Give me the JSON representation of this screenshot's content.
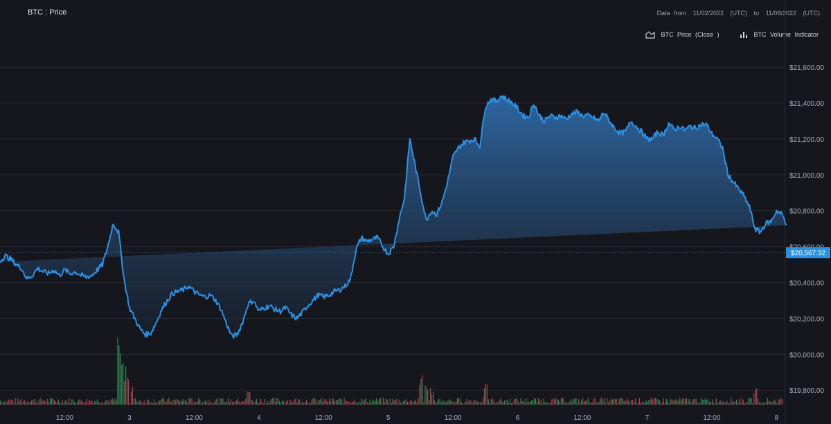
{
  "header": {
    "title": "BTC : Price",
    "range_prefix": "Data  from",
    "range_start": "11/02/2022",
    "range_start_tz": "(UTC)",
    "range_to": "to",
    "range_end": "11/08/2022",
    "range_end_tz": "(UTC)"
  },
  "legend": {
    "price_label": "BTC  Price  (Close  )",
    "volume_label": "BTC  Volume  Indicator",
    "price_icon": "area-chart-icon",
    "volume_icon": "bar-chart-icon"
  },
  "current_price_label": "$20,567.32",
  "colors": {
    "background": "#16171c",
    "line": "#2a92e6",
    "fill_top": "#2f6aa8",
    "price_tag": "#2a92e6",
    "volume_up": "#2f9a5a",
    "volume_down": "#c0465a"
  },
  "chart_data": {
    "type": "area",
    "title": "BTC : Price",
    "xlabel": "",
    "ylabel": "",
    "ylim": [
      19720,
      21720
    ],
    "y_ticks": [
      "$19,800.00",
      "$20,000.00",
      "$20,200.00",
      "$20,400.00",
      "$20,600.00",
      "$20,800.00",
      "$21,000.00",
      "$21,200.00",
      "$21,400.00",
      "$21,600.00"
    ],
    "y_tick_values": [
      19800,
      20000,
      20200,
      20400,
      20600,
      20800,
      21000,
      21200,
      21400,
      21600
    ],
    "x_ticks": [
      "12:00",
      "3",
      "12:00",
      "4",
      "12:00",
      "5",
      "12:00",
      "6",
      "12:00",
      "7",
      "12:00",
      "8"
    ],
    "x_tick_hours": [
      12,
      24,
      36,
      48,
      60,
      72,
      84,
      96,
      108,
      120,
      132,
      144
    ],
    "grid": true,
    "legend_position": "top-right",
    "series": [
      {
        "name": "BTC  Price  (Close  )",
        "x_hours": [
          0,
          1,
          2,
          3,
          4,
          5,
          6,
          7,
          8,
          9,
          10,
          11,
          12,
          13,
          14,
          15,
          16,
          17,
          18,
          19,
          20,
          21,
          22,
          23,
          24,
          25,
          26,
          27,
          28,
          29,
          30,
          31,
          32,
          33,
          34,
          35,
          36,
          37,
          38,
          39,
          40,
          41,
          42,
          43,
          44,
          45,
          46,
          47,
          48,
          49,
          50,
          51,
          52,
          53,
          54,
          55,
          56,
          57,
          58,
          59,
          60,
          61,
          62,
          63,
          64,
          65,
          66,
          67,
          68,
          69,
          70,
          71,
          72,
          73,
          74,
          75,
          76,
          77,
          78,
          79,
          80,
          81,
          82,
          83,
          84,
          85,
          86,
          87,
          88,
          89,
          90,
          91,
          92,
          93,
          94,
          95,
          96,
          97,
          98,
          99,
          100,
          101,
          102,
          103,
          104,
          105,
          106,
          107,
          108,
          109,
          110,
          111,
          112,
          113,
          114,
          115,
          116,
          117,
          118,
          119,
          120,
          121,
          122,
          123,
          124,
          125,
          126,
          127,
          128,
          129,
          130,
          131,
          132,
          133,
          134,
          135,
          136,
          137,
          138,
          139,
          140,
          141,
          142,
          143,
          144,
          145
        ],
        "values": [
          20520,
          20550,
          20530,
          20500,
          20480,
          20420,
          20440,
          20480,
          20460,
          20450,
          20470,
          20440,
          20470,
          20450,
          20460,
          20440,
          20430,
          20440,
          20470,
          20500,
          20600,
          20730,
          20680,
          20420,
          20260,
          20200,
          20140,
          20110,
          20120,
          20180,
          20250,
          20300,
          20340,
          20350,
          20360,
          20380,
          20350,
          20330,
          20320,
          20330,
          20300,
          20250,
          20170,
          20100,
          20110,
          20180,
          20280,
          20300,
          20240,
          20260,
          20270,
          20250,
          20240,
          20260,
          20220,
          20200,
          20230,
          20270,
          20300,
          20330,
          20320,
          20330,
          20350,
          20360,
          20380,
          20420,
          20580,
          20650,
          20630,
          20640,
          20650,
          20600,
          20560,
          20600,
          20750,
          20870,
          21200,
          21050,
          20900,
          20750,
          20800,
          20780,
          20850,
          20960,
          21100,
          21150,
          21180,
          21190,
          21200,
          21160,
          21380,
          21420,
          21410,
          21440,
          21420,
          21400,
          21370,
          21330,
          21320,
          21400,
          21330,
          21300,
          21330,
          21320,
          21330,
          21310,
          21340,
          21350,
          21330,
          21330,
          21320,
          21300,
          21350,
          21300,
          21260,
          21230,
          21240,
          21300,
          21270,
          21240,
          21200,
          21200,
          21240,
          21220,
          21290,
          21250,
          21270,
          21250,
          21270,
          21260,
          21280,
          21280,
          21230,
          21200,
          21150,
          21000,
          20960,
          20920,
          20880,
          20820,
          20700,
          20680,
          20730,
          20740,
          20800,
          20780,
          20720,
          20720,
          20700,
          20740,
          20850,
          20750,
          20460,
          20567
        ]
      }
    ],
    "volume": {
      "name": "BTC  Volume  Indicator",
      "description_values": "relative volume (0-1)",
      "spikes": [
        {
          "hour": 22,
          "value": 1.0
        },
        {
          "hour": 22.5,
          "value": 0.75
        },
        {
          "hour": 23,
          "value": 0.55
        },
        {
          "hour": 23.6,
          "value": 0.45
        },
        {
          "hour": 24.4,
          "value": 0.3
        },
        {
          "hour": 46,
          "value": 0.2
        },
        {
          "hour": 78,
          "value": 0.45
        },
        {
          "hour": 79,
          "value": 0.3
        },
        {
          "hour": 80,
          "value": 0.25
        },
        {
          "hour": 90,
          "value": 0.3
        },
        {
          "hour": 140,
          "value": 0.25
        }
      ],
      "baseline": 0.06
    }
  }
}
